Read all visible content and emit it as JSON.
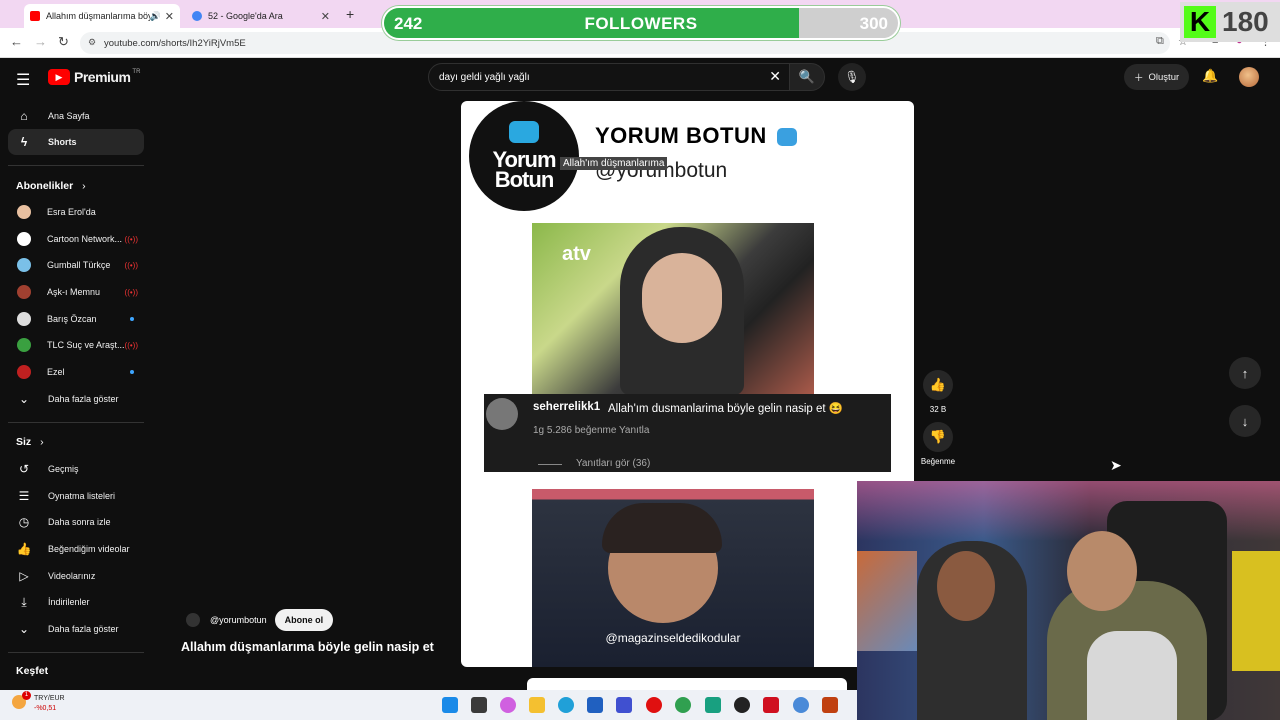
{
  "browser": {
    "tabs": [
      {
        "label": "Allahım düşmanlarıma böy",
        "active": true
      },
      {
        "label": "52 - Google'da Ara",
        "active": false
      }
    ],
    "url": "youtube.com/shorts/Ih2YiRjVm5E"
  },
  "overlay": {
    "followers_current": "242",
    "followers_label": "FOLLOWERS",
    "followers_goal": "300",
    "followers_progress": 0.8067,
    "kick_letter": "K",
    "kick_count": "180"
  },
  "header": {
    "logo_text": "Premium",
    "logo_country": "TR",
    "search_value": "dayı geldi yağlı yağlı",
    "create_label": "Oluştur"
  },
  "sidebar": {
    "main": [
      {
        "label": "Ana Sayfa",
        "icon": "home-icon"
      },
      {
        "label": "Shorts",
        "icon": "shorts-icon"
      }
    ],
    "subs_title": "Abonelikler",
    "subscriptions": [
      {
        "label": "Esra Erol'da",
        "color": "#e8c0a0",
        "badge": ""
      },
      {
        "label": "Cartoon Network...",
        "color": "#ffffff",
        "badge": "live"
      },
      {
        "label": "Gumball Türkçe",
        "color": "#7ac0e8",
        "badge": "live"
      },
      {
        "label": "Aşk-ı Memnu",
        "color": "#a04030",
        "badge": "live"
      },
      {
        "label": "Barış Özcan",
        "color": "#dddddd",
        "badge": "new"
      },
      {
        "label": "TLC Suç ve Araşt...",
        "color": "#3aa040",
        "badge": "live"
      },
      {
        "label": "Ezel",
        "color": "#c02020",
        "badge": "new"
      }
    ],
    "subs_more": "Daha fazla göster",
    "you_title": "Siz",
    "you_items": [
      {
        "label": "Geçmiş",
        "icon": "history-icon"
      },
      {
        "label": "Oynatma listeleri",
        "icon": "playlist-icon"
      },
      {
        "label": "Daha sonra izle",
        "icon": "clock-icon"
      },
      {
        "label": "Beğendiğim videolar",
        "icon": "thumbs-up-icon"
      },
      {
        "label": "Videolarınız",
        "icon": "video-icon"
      },
      {
        "label": "İndirilenler",
        "icon": "download-icon"
      }
    ],
    "you_more": "Daha fazla göster",
    "explore_title": "Keşfet"
  },
  "short": {
    "brand_line1": "Yorum",
    "brand_line2": "Botun",
    "brand_title": "YORUM BOTUN",
    "brand_handle": "@yorumbotun",
    "tooltip": "Allah'ım düşmanlarıma",
    "video_logo": "atv",
    "comment_user": "seherrelikk1",
    "comment_text": "Allah'ım dusmanlarima böyle gelin nasip et 😆",
    "comment_meta": "1g    5.286 beğenme    Yanıtla",
    "comment_replies": "Yanıtları gör (36)",
    "watermark": "@magazinseldedikodular",
    "channel": "@yorumbotun",
    "subscribe_label": "Abone ol",
    "title": "Allahım düşmanlarıma böyle gelin nasip et",
    "likes": "32 B",
    "dislike_label": "Beğenme"
  },
  "taskbar": {
    "ticker": "TRY/EUR",
    "ticker_change": "-%0,51",
    "notif": "1"
  }
}
